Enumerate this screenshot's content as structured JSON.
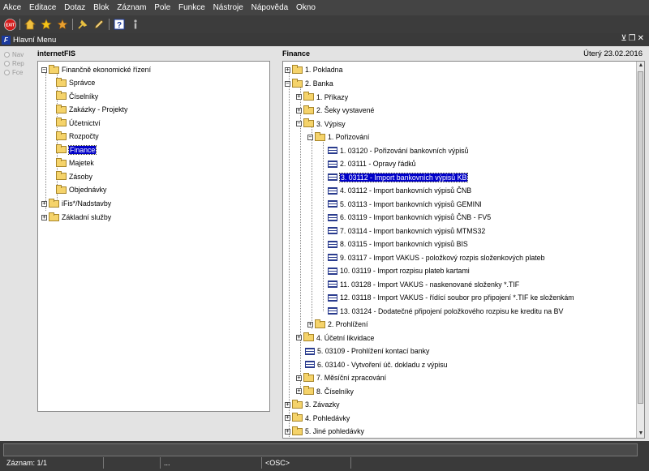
{
  "menu": [
    "Akce",
    "Editace",
    "Dotaz",
    "Blok",
    "Záznam",
    "Pole",
    "Funkce",
    "Nástroje",
    "Nápověda",
    "Okno"
  ],
  "toolbar": {
    "icons": [
      "exit-icon",
      "home-icon",
      "star-icon",
      "star-outline-icon",
      "pin-icon",
      "pencil-icon",
      "help-icon",
      "info-icon"
    ]
  },
  "window": {
    "title": "Hlavní Menu",
    "icon_letter": "F"
  },
  "radios": [
    "Nav",
    "Rep",
    "Fce"
  ],
  "left": {
    "header": "internetFIS",
    "root": "Finančně ekonomické řízení",
    "items": [
      "Správce",
      "Číselníky",
      "Zakázky - Projekty",
      "Účetnictví",
      "Rozpočty",
      "Finance",
      "Majetek",
      "Zásoby",
      "Objednávky"
    ],
    "others": [
      "iFis*/Nadstavby",
      "Základní služby"
    ]
  },
  "right": {
    "header": "Finance",
    "date": "Úterý  23.02.2016",
    "n1": "1. Pokladna",
    "n2": "2. Banka",
    "n21": "1. Příkazy",
    "n22": "2. Šeky vystavené",
    "n23": "3. Výpisy",
    "n231": "1. Pořizování",
    "forms": [
      "1. 03120 - Pořizování bankovních výpisů",
      "2. 03111 - Opravy řádků",
      "3. 03112 - Import bankovních výpisů KB",
      "4. 03112 - Import bankovních výpisů ČNB",
      "5. 03113 - Import bankovních výpisů GEMINI",
      "6. 03119 - Import bankovních výpisů ČNB - FV5",
      "7. 03114 - Import bankovních výpisů MTMS32",
      "8. 03115 - Import bankovních výpisů BIS",
      "9. 03117 - Import VAKUS - položkový rozpis složenkových plateb",
      "10. 03119 - Import rozpisu plateb kartami",
      "11. 03128 - Import VAKUS - naskenované složenky *.TIF",
      "12. 03118 - Import VAKUS - řídící soubor pro připojení *.TIF ke složenkám",
      "13. 03124 - Dodatečné připojení položkového rozpisu ke kreditu na BV"
    ],
    "n232": "2. Prohlížení",
    "n24": "4. Účetní likvidace",
    "n25": "5. 03109 - Prohlížení kontací banky",
    "n26": "6. 03140 - Vytvoření úč. dokladu z výpisu",
    "n27": "7. Měsíční zpracování",
    "n28": "8. Číselníky",
    "n3": "3. Závazky",
    "n4": "4. Pohledávky",
    "n5": "5. Jiné pohledávky"
  },
  "status": {
    "record": "Záznam: 1/1",
    "c2": "...",
    "osc": "<OSC>"
  }
}
